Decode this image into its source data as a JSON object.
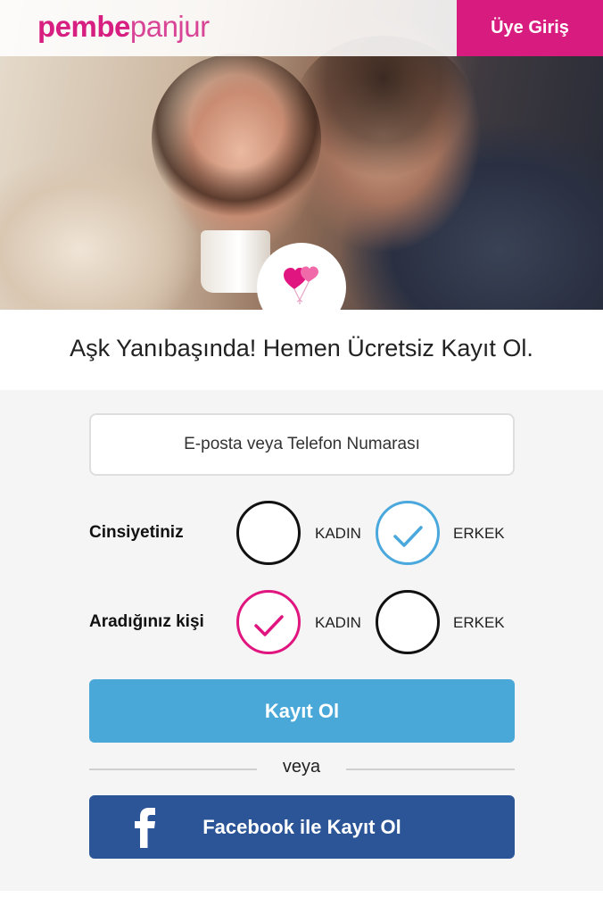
{
  "header": {
    "logo_part1": "pembe",
    "logo_part2": "panjur",
    "login_label": "Üye Giriş"
  },
  "hero": {
    "badge_icon": "heart-balloons-icon",
    "tagline": "Aşk Yanıbaşında! Hemen Ücretsiz Kayıt Ol."
  },
  "form": {
    "contact_input": {
      "placeholder": "E-posta veya Telefon Numarası",
      "value": ""
    },
    "gender": {
      "label": "Cinsiyetiniz",
      "options": [
        {
          "label": "KADIN",
          "selected": false
        },
        {
          "label": "ERKEK",
          "selected": true
        }
      ]
    },
    "seeking": {
      "label": "Aradığınız kişi",
      "options": [
        {
          "label": "KADIN",
          "selected": true
        },
        {
          "label": "ERKEK",
          "selected": false
        }
      ]
    },
    "submit_label": "Kayıt Ol",
    "divider_text": "veya",
    "facebook_label": "Facebook ile Kayıt Ol",
    "facebook_icon": "facebook-icon",
    "check_icon": "checkmark-icon"
  },
  "colors": {
    "brand": "#d81b7f",
    "female": "#e0157f",
    "male": "#4aa8dc",
    "submit": "#4aa8d8",
    "facebook": "#2b5597"
  }
}
